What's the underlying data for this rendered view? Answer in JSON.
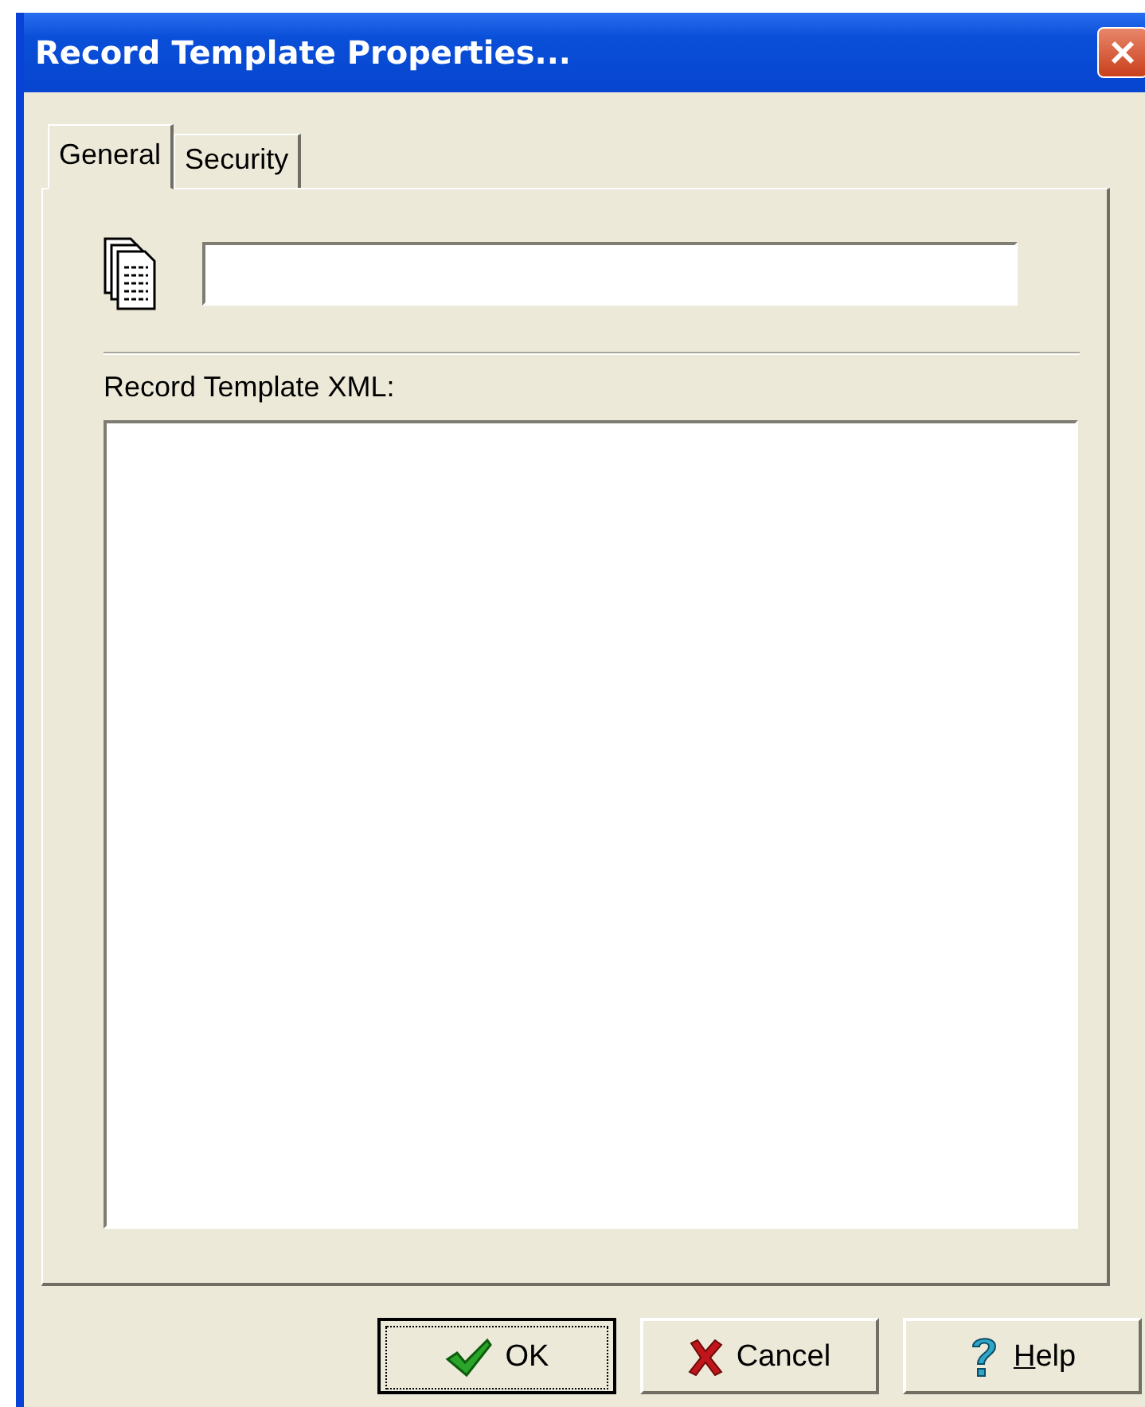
{
  "window": {
    "title": "Record Template Properties..."
  },
  "tabs": [
    {
      "label": "General",
      "selected": true
    },
    {
      "label": "Security",
      "selected": false
    }
  ],
  "xml_label": "Record Template XML:",
  "buttons": [
    {
      "kind": "ok",
      "label": "OK",
      "default": true,
      "mnemonic_underlined": false
    },
    {
      "kind": "cancel",
      "label": "Cancel",
      "default": false,
      "mnemonic_underlined": false
    },
    {
      "kind": "help",
      "label": "Help",
      "default": false,
      "mnemonic_underlined": true
    }
  ]
}
